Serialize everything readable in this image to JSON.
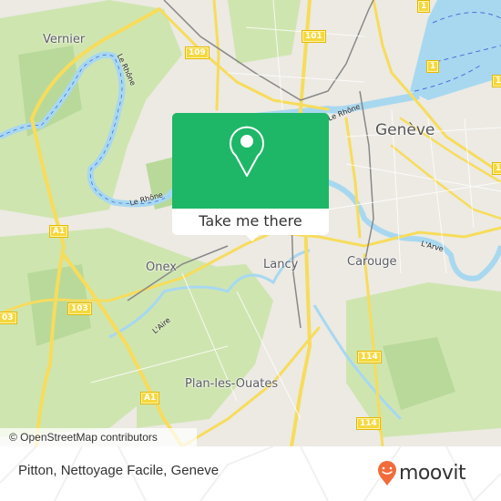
{
  "map": {
    "places": [
      {
        "name": "Vernier",
        "size": "normal"
      },
      {
        "name": "Genève",
        "size": "big"
      },
      {
        "name": "Onex",
        "size": "normal"
      },
      {
        "name": "Lancy",
        "size": "normal"
      },
      {
        "name": "Carouge",
        "size": "normal"
      },
      {
        "name": "Plan-les-Ouates",
        "size": "normal"
      }
    ],
    "rivers": [
      "Le Rhône",
      "Le Rhône",
      "Le Rhône",
      "L'Arve",
      "L'Aire"
    ],
    "road_shields": [
      "109",
      "101",
      "1",
      "1",
      "1",
      "1",
      "A1",
      "103",
      "03",
      "A1",
      "114",
      "114"
    ],
    "colors": {
      "water": "#a8d8f0",
      "green": "#c8e2a6",
      "road_major": "#f7dc5c",
      "land": "#eceae3"
    }
  },
  "attribution": "© OpenStreetMap contributors",
  "popup": {
    "icon": "location-pin-icon",
    "button_label": "Take me there",
    "color": "#1eb767"
  },
  "footer": {
    "place_name": "Pitton, Nettoyage Facile, Geneve",
    "brand": "moovit",
    "brand_color": "#f26b3a"
  }
}
